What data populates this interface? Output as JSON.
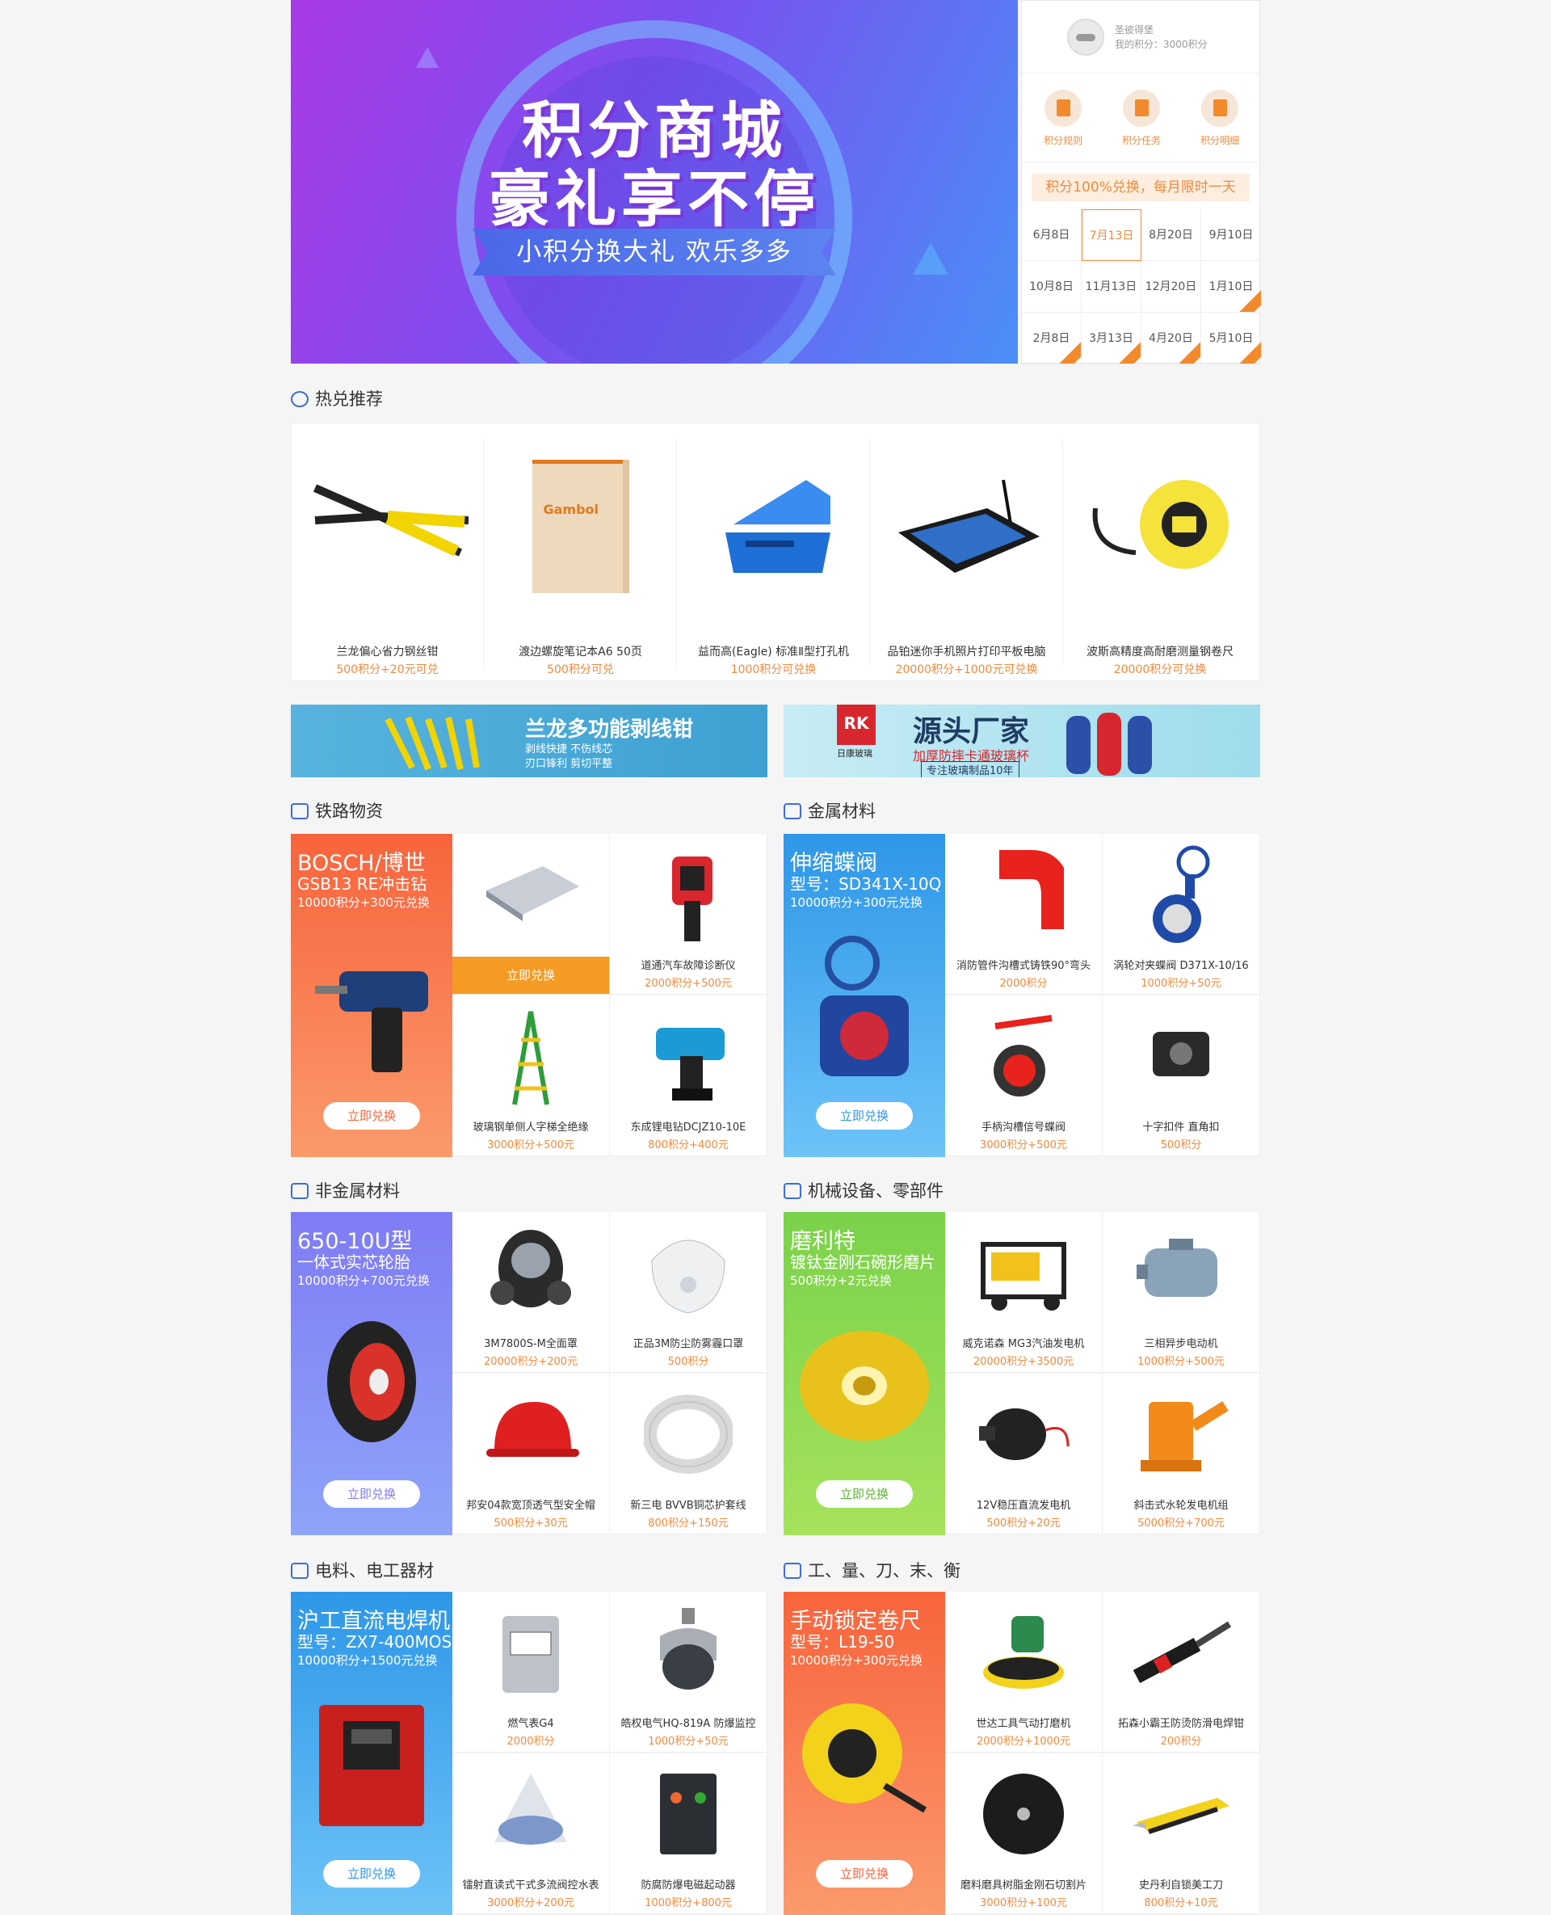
{
  "banner": {
    "title1": "积分商城",
    "title2": "豪礼享不停",
    "subtitle": "小积分换大礼 欢乐多多"
  },
  "user": {
    "name": "圣彼得堡",
    "points": "我的积分：3000积分"
  },
  "quicklinks": [
    {
      "label": "积分规则"
    },
    {
      "label": "积分任务"
    },
    {
      "label": "积分明细"
    }
  ],
  "promo": "积分100%兑换，每月限时一天",
  "dates": [
    "6月8日",
    "7月13日",
    "8月20日",
    "9月10日",
    "10月8日",
    "11月13日",
    "12月20日",
    "1月10日",
    "2月8日",
    "3月13日",
    "4月20日",
    "5月10日"
  ],
  "hot": {
    "title": "热兑推荐",
    "items": [
      {
        "name": "兰龙偏心省力钢丝钳",
        "price": "500积分+20元可兑"
      },
      {
        "name": "渡边螺旋笔记本A6 50页",
        "price": "500积分可兑"
      },
      {
        "name": "益而高(Eagle) 标准Ⅱ型打孔机",
        "price": "1000积分可兑换"
      },
      {
        "name": "品铂迷你手机照片打印平板电脑",
        "price": "20000积分+1000元可兑换"
      },
      {
        "name": "波斯高精度高耐磨测量钢卷尺",
        "price": "20000积分可兑换"
      }
    ]
  },
  "ads": [
    {
      "text": "兰龙多功能剥线钳",
      "sub1": "剥线快捷 不伤线芯",
      "sub2": "刃口锋利 剪切平整"
    },
    {
      "brand": "RK",
      "brand_sub": "日康玻璃",
      "text": "源头厂家",
      "sub1": "加厚防摔卡通玻璃杯",
      "sub2": "专注玻璃制品10年"
    }
  ],
  "categories": [
    {
      "title": "铁路物资",
      "feature": {
        "t": "BOSCH/博世",
        "s": "GSB13 RE冲击钻",
        "p": "10000积分+300元兑换",
        "btn": "立即兑换"
      },
      "items": [
        {
          "name": "",
          "price": "",
          "btn": "立即兑换"
        },
        {
          "name": "道通汽车故障诊断仪",
          "price": "2000积分+500元"
        },
        {
          "name": "玻璃钢单侧人字梯全绝缘",
          "price": "3000积分+500元"
        },
        {
          "name": "东成锂电钻DCJZ10-10E",
          "price": "800积分+400元"
        }
      ]
    },
    {
      "title": "金属材料",
      "feature": {
        "t": "伸缩蝶阀",
        "s": "型号：SD341X-10Q",
        "p": "10000积分+300元兑换",
        "btn": "立即兑换"
      },
      "items": [
        {
          "name": "消防管件沟槽式铸铁90°弯头",
          "price": "2000积分"
        },
        {
          "name": "涡轮对夹蝶阀 D371X-10/16",
          "price": "1000积分+50元"
        },
        {
          "name": "手柄沟槽信号蝶阀",
          "price": "3000积分+500元"
        },
        {
          "name": "十字扣件 直角扣",
          "price": "500积分"
        }
      ]
    },
    {
      "title": "非金属材料",
      "feature": {
        "t": "650-10U型",
        "s": "一体式实芯轮胎",
        "p": "10000积分+700元兑换",
        "btn": "立即兑换"
      },
      "items": [
        {
          "name": "3M7800S-M全面罩",
          "price": "20000积分+200元"
        },
        {
          "name": "正品3M防尘防雾霾口罩",
          "price": "500积分"
        },
        {
          "name": "邦安04款宽顶透气型安全帽",
          "price": "500积分+30元"
        },
        {
          "name": "新三电 BVVB铜芯护套线",
          "price": "800积分+150元"
        }
      ]
    },
    {
      "title": "机械设备、零部件",
      "feature": {
        "t": "磨利特",
        "s": "镀钛金刚石碗形磨片",
        "p": "500积分+2元兑换",
        "btn": "立即兑换"
      },
      "items": [
        {
          "name": "威克诺森 MG3汽油发电机",
          "price": "20000积分+3500元"
        },
        {
          "name": "三相异步电动机",
          "price": "1000积分+500元"
        },
        {
          "name": "12V稳压直流发电机",
          "price": "500积分+20元"
        },
        {
          "name": "斜击式水轮发电机组",
          "price": "5000积分+700元"
        }
      ]
    },
    {
      "title": "电料、电工器材",
      "feature": {
        "t": "沪工直流电焊机",
        "s": "型号：ZX7-400MOS",
        "p": "10000积分+1500元兑换",
        "btn": "立即兑换"
      },
      "items": [
        {
          "name": "燃气表G4",
          "price": "2000积分"
        },
        {
          "name": "皓权电气HQ-819A 防爆监控",
          "price": "1000积分+50元"
        },
        {
          "name": "镭射直读式干式多流阀控水表",
          "price": "3000积分+200元"
        },
        {
          "name": "防腐防爆电磁起动器",
          "price": "1000积分+800元"
        }
      ]
    },
    {
      "title": "工、量、刀、末、衡",
      "feature": {
        "t": "手动锁定卷尺",
        "s": "型号：L19-50",
        "p": "10000积分+300元兑换",
        "btn": "立即兑换"
      },
      "items": [
        {
          "name": "世达工具气动打磨机",
          "price": "2000积分+1000元"
        },
        {
          "name": "拓森小霸王防烫防滑电焊钳",
          "price": "200积分"
        },
        {
          "name": "磨料磨具树脂金刚石切割片",
          "price": "3000积分+100元"
        },
        {
          "name": "史丹利自锁美工刀",
          "price": "800积分+10元"
        }
      ]
    }
  ]
}
